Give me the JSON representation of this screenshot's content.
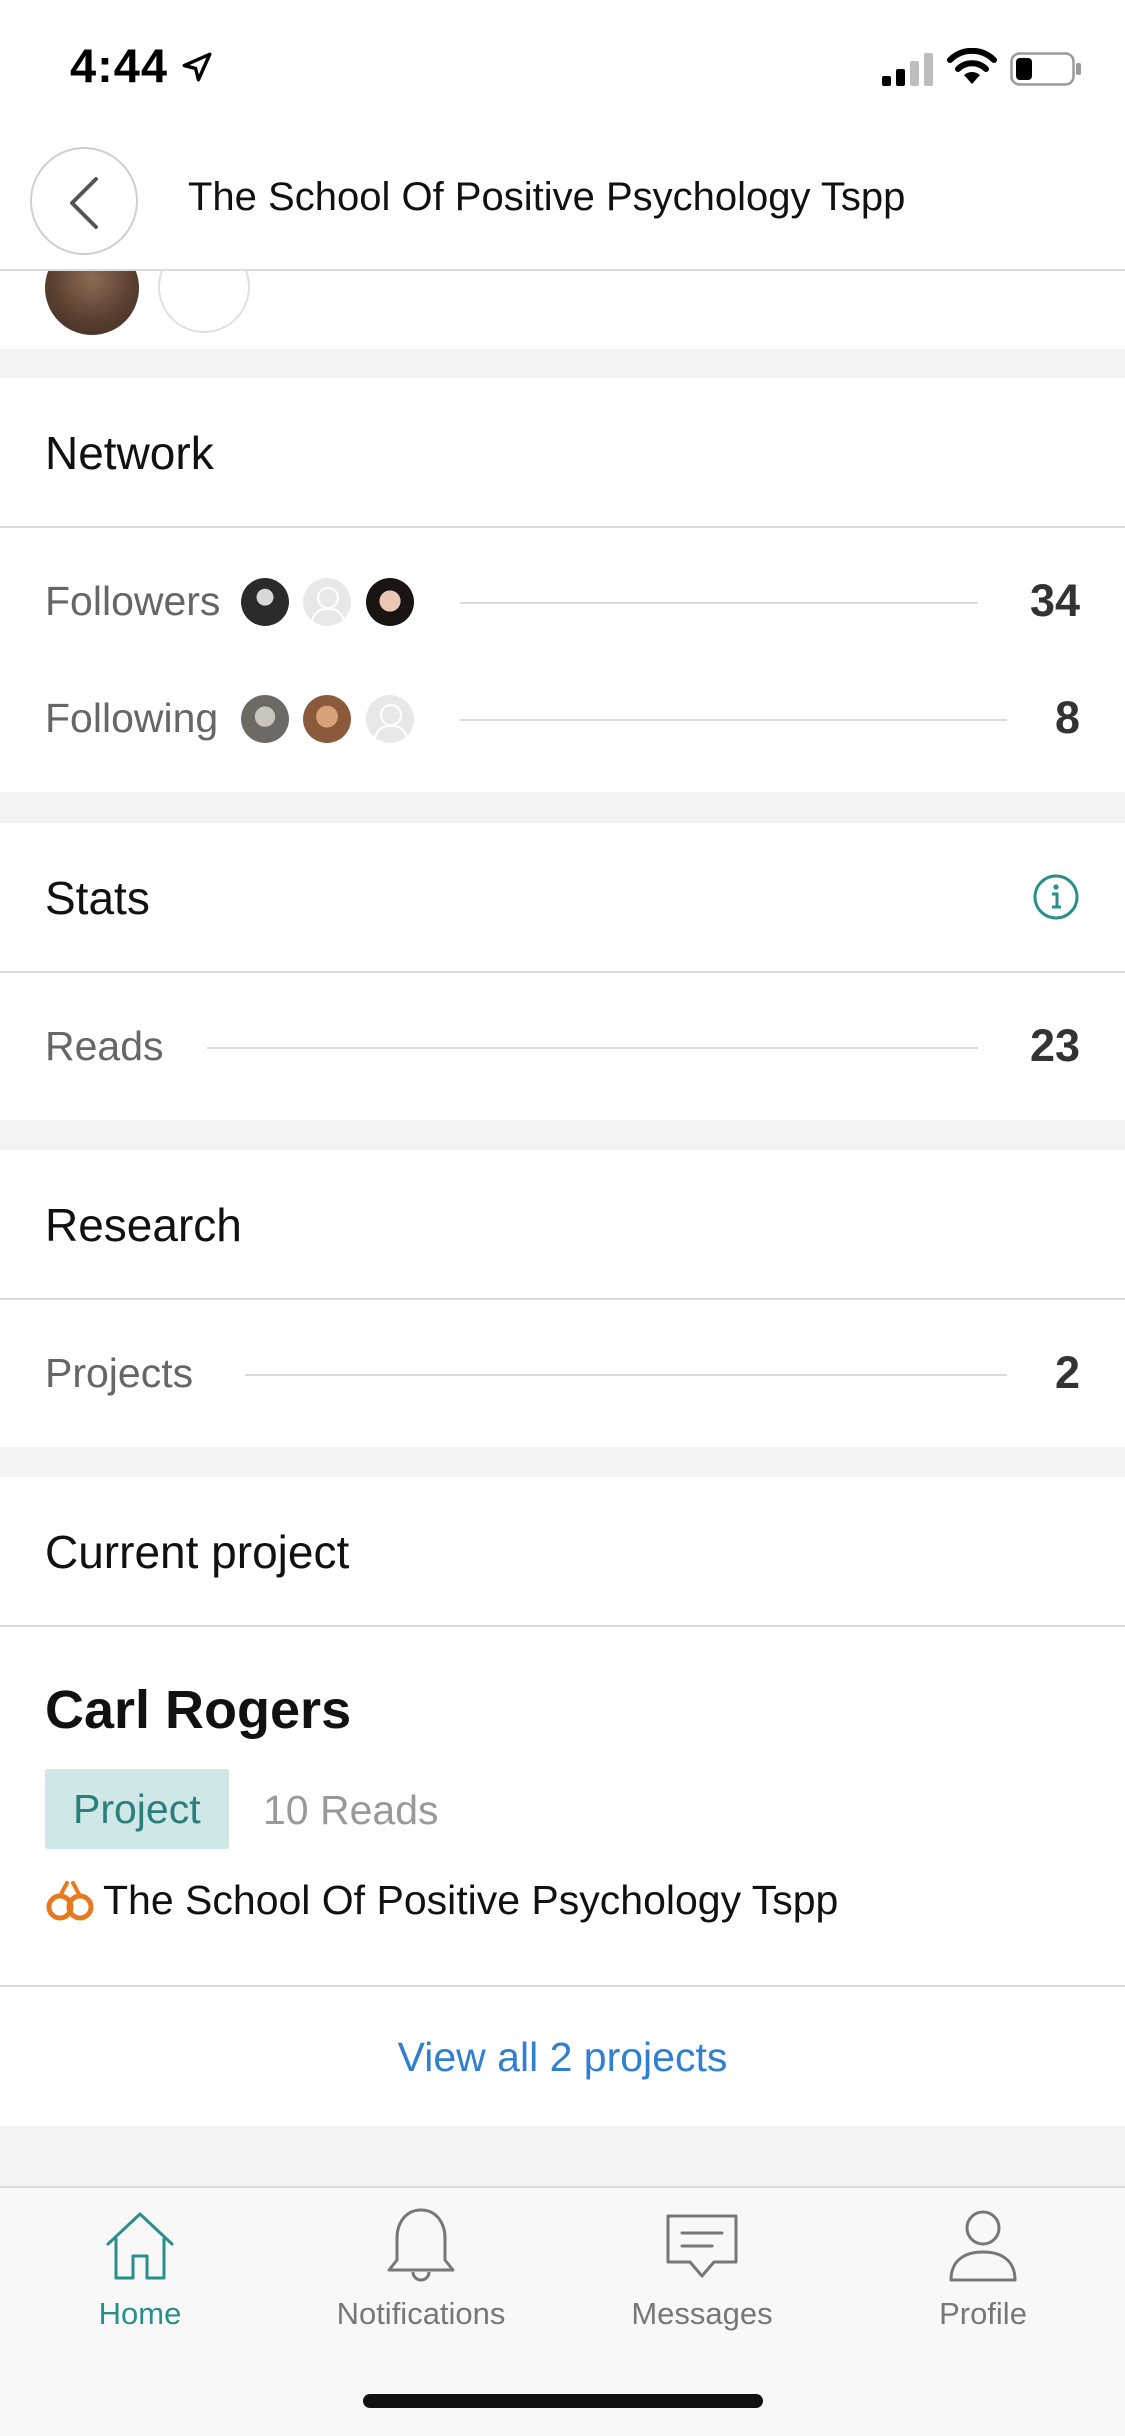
{
  "status_bar": {
    "time": "4:44"
  },
  "header": {
    "title": "The School Of Positive Psychology Tspp"
  },
  "network": {
    "title": "Network",
    "followers": {
      "label": "Followers",
      "count": "34"
    },
    "following": {
      "label": "Following",
      "count": "8"
    }
  },
  "stats": {
    "title": "Stats",
    "reads": {
      "label": "Reads",
      "count": "23"
    }
  },
  "research": {
    "title": "Research",
    "projects": {
      "label": "Projects",
      "count": "2"
    }
  },
  "current_project": {
    "title": "Current project",
    "project_name": "Carl Rogers",
    "badge": "Project",
    "reads": "10 Reads",
    "organization": "The School Of Positive Psychology Tspp",
    "view_all": "View all 2 projects"
  },
  "tabbar": {
    "home": "Home",
    "notifications": "Notifications",
    "messages": "Messages",
    "profile": "Profile"
  },
  "colors": {
    "accent": "#2a8f8a",
    "link": "#2f80d1",
    "badge_bg": "#cfe7e6"
  }
}
